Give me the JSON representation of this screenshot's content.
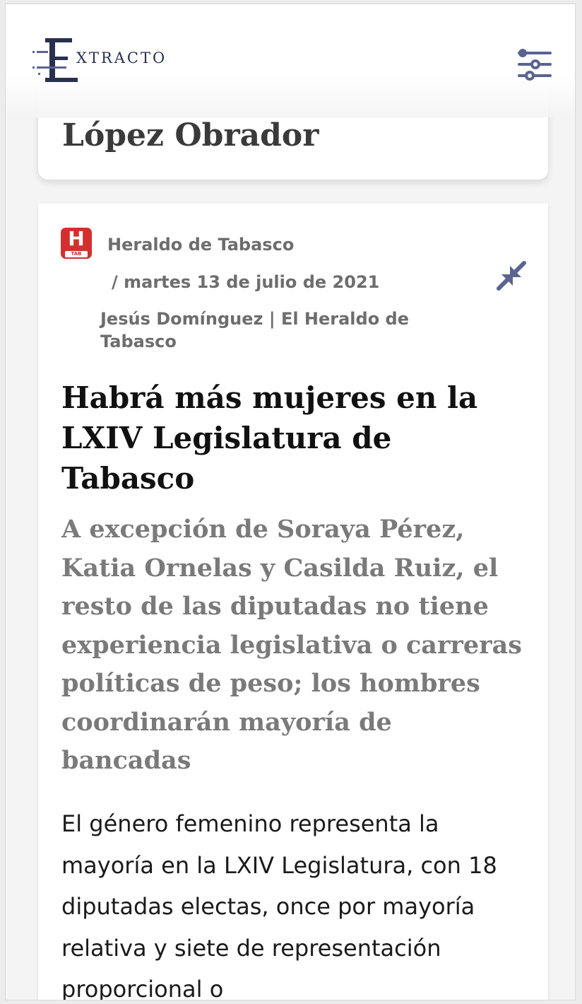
{
  "app": {
    "logo_text": "XTRACTO",
    "logo_letter": "E"
  },
  "icons": {
    "filter": "sliders-icon",
    "collapse": "collapse-arrows-icon",
    "source": "heraldo-logo-icon"
  },
  "colors": {
    "accent": "#5b6491",
    "source_red": "#d32f2f",
    "muted": "#7a7a7a"
  },
  "previous_card": {
    "title_fragment": "López Obrador"
  },
  "article": {
    "source_logo_letter": "H",
    "source_logo_sub": "TAB",
    "source": "Heraldo de Tabasco",
    "date": "/ martes 13 de julio de 2021",
    "author": "Jesús Domínguez | El Heraldo de Tabasco",
    "title": "Habrá más mujeres en la LXIV Legislatura de Tabasco",
    "subtitle": "A excepción de Soraya Pérez, Katia Ornelas y Casilda Ruiz, el resto de las diputadas no tiene experiencia legislativa o carreras políticas de peso; los hombres coordinarán mayoría de bancadas",
    "body": "El género femenino representa la mayoría en la LXIV Legislatura, con 18 diputadas electas, once por mayoría relativa y siete de representación proporcional o"
  }
}
